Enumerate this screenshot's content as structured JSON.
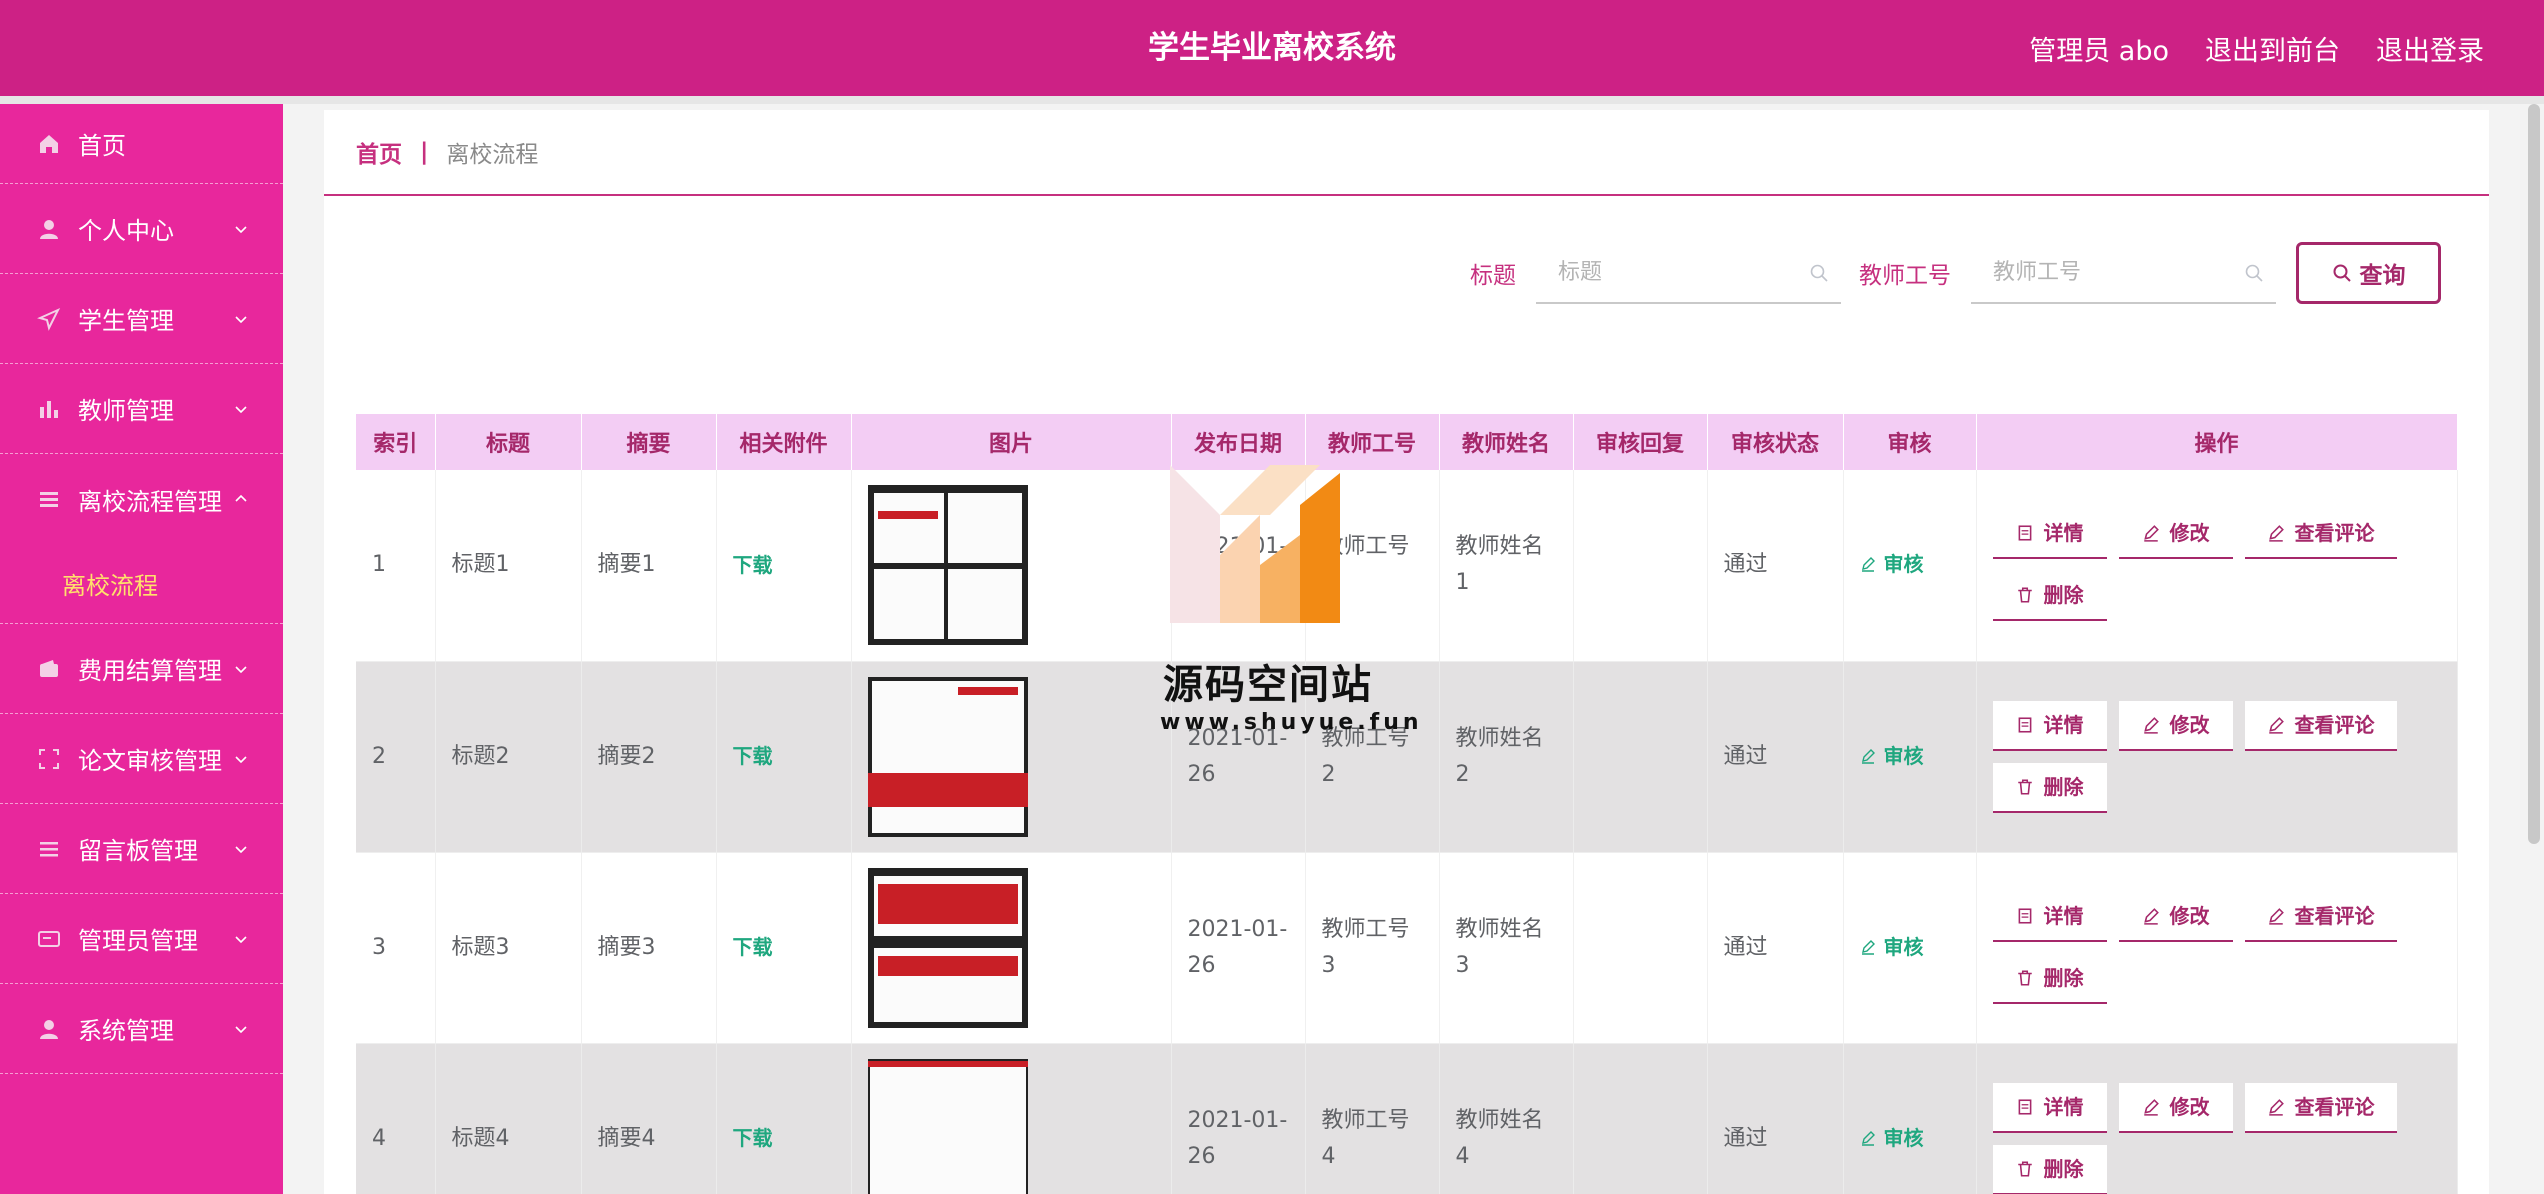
{
  "header": {
    "title": "学生毕业离校系统",
    "admin_label": "管理员 abo",
    "to_front": "退出到前台",
    "logout": "退出登录"
  },
  "sidebar": {
    "items": [
      {
        "label": "首页",
        "icon": "home-icon"
      },
      {
        "label": "个人中心",
        "icon": "user-icon"
      },
      {
        "label": "学生管理",
        "icon": "send-icon"
      },
      {
        "label": "教师管理",
        "icon": "bar-chart-icon"
      },
      {
        "label": "离校流程管理",
        "icon": "list-icon",
        "expanded": true
      },
      {
        "label": "离校流程",
        "sub": true
      },
      {
        "label": "费用结算管理",
        "icon": "wallet-icon"
      },
      {
        "label": "论文审核管理",
        "icon": "scan-icon"
      },
      {
        "label": "留言板管理",
        "icon": "menu-icon"
      },
      {
        "label": "管理员管理",
        "icon": "card-icon"
      },
      {
        "label": "系统管理",
        "icon": "user-icon"
      }
    ]
  },
  "breadcrumb": {
    "home": "首页",
    "sep": "|",
    "current": "离校流程"
  },
  "search": {
    "title_label": "标题",
    "title_placeholder": "标题",
    "teacher_label": "教师工号",
    "teacher_placeholder": "教师工号",
    "query_label": "查询"
  },
  "table": {
    "headers": [
      "索引",
      "标题",
      "摘要",
      "相关附件",
      "图片",
      "发布日期",
      "教师工号",
      "教师姓名",
      "审核回复",
      "审核状态",
      "审核",
      "操作"
    ],
    "rows": [
      {
        "index": "1",
        "title": "标题1",
        "summary": "摘要1",
        "attachment": "下载",
        "date": "2021-01-26",
        "teacher_no": "教师工号1",
        "teacher_name": "教师姓名1",
        "reply": "",
        "status": "通过",
        "audit": "审核"
      },
      {
        "index": "2",
        "title": "标题2",
        "summary": "摘要2",
        "attachment": "下载",
        "date": "2021-01-26",
        "teacher_no": "教师工号2",
        "teacher_name": "教师姓名2",
        "reply": "",
        "status": "通过",
        "audit": "审核"
      },
      {
        "index": "3",
        "title": "标题3",
        "summary": "摘要3",
        "attachment": "下载",
        "date": "2021-01-26",
        "teacher_no": "教师工号3",
        "teacher_name": "教师姓名3",
        "reply": "",
        "status": "通过",
        "audit": "审核"
      },
      {
        "index": "4",
        "title": "标题4",
        "summary": "摘要4",
        "attachment": "下载",
        "date": "2021-01-26",
        "teacher_no": "教师工号4",
        "teacher_name": "教师姓名4",
        "reply": "",
        "status": "通过",
        "audit": "审核"
      }
    ],
    "ops": {
      "detail": "详情",
      "edit": "修改",
      "comments": "查看评论",
      "delete": "删除"
    }
  },
  "watermark": {
    "title": "源码空间站",
    "url": "www.shuyue.fun"
  },
  "colors": {
    "header": "#cd2185",
    "sidebar": "#e8279c",
    "accent": "#a5286a",
    "success": "#1fa77f",
    "active_sub": "#ffe16b"
  }
}
